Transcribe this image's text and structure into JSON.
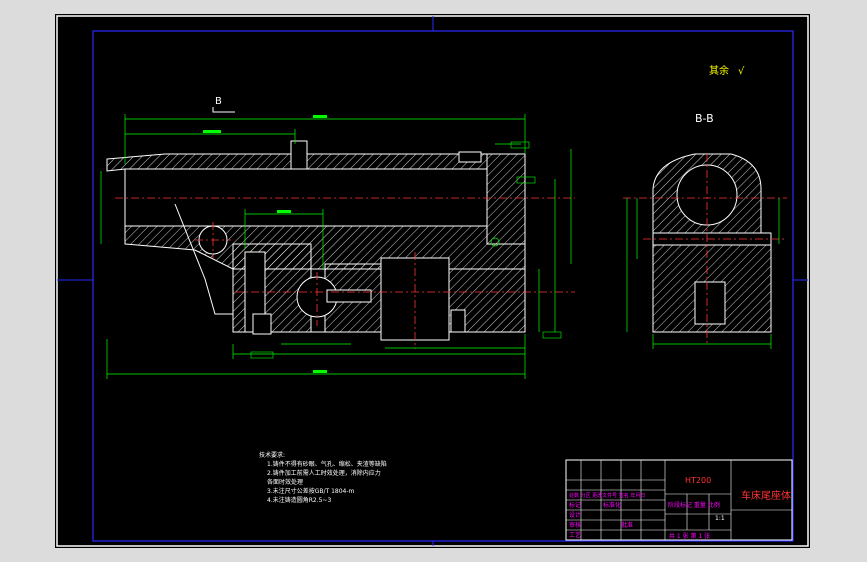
{
  "drawing": {
    "roughness_note": "其余",
    "section_label": "B-B",
    "cut_marker": "B",
    "tech_requirements": {
      "title": "技术要求:",
      "items": [
        "1.铸件不得有砂眼、气孔、缩松、夹渣等缺陷",
        "2.铸件加工前需人工时效处理，消除内应力",
        "  各面时效处理",
        "3.未注尺寸公差按GB/T 1804-m",
        "4.未注铸造圆角R2.5~3"
      ]
    },
    "title_block": {
      "material": "HT200",
      "part_name": "车床尾座体",
      "scale": "1:1",
      "sheet_info": "共 1 张 第 1 张",
      "row_labels": [
        "标记",
        "设计",
        "审核",
        "工艺"
      ],
      "row_values": [
        "处数 分区 更改文件号 签名 年月日",
        "标准化",
        "批准"
      ],
      "stage_headers": "阶段标记 重量 比例"
    },
    "colors": {
      "sheet": "#000000",
      "frame": "#ffffff",
      "inner_frame": "#2222ff",
      "outline": "#ffffff",
      "dimension": "#00ff00",
      "centerline": "#ff3333",
      "text_yellow": "#ffff00",
      "text_magenta": "#ff00ff",
      "text_red": "#ff3333"
    }
  }
}
